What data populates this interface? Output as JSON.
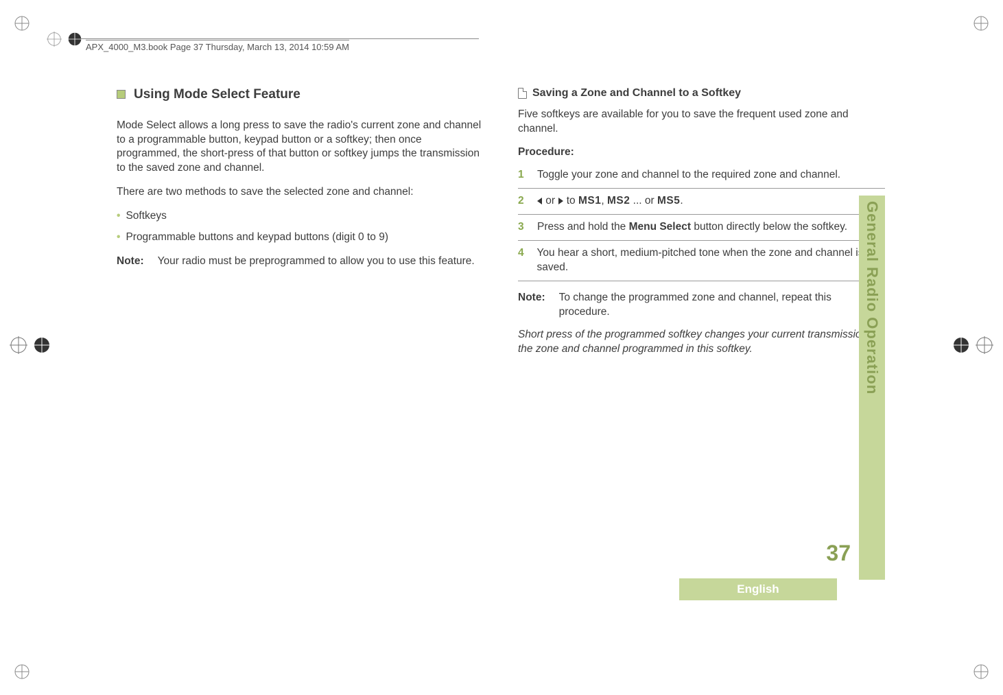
{
  "header": "APX_4000_M3.book  Page 37  Thursday, March 13, 2014  10:59 AM",
  "sideTab": "General Radio Operation",
  "pageNumber": "37",
  "language": "English",
  "left": {
    "title": "Using Mode Select Feature",
    "p1": "Mode Select allows a long press to save the radio's current zone and channel to a programmable button, keypad button or a softkey; then once programmed, the short-press of that button or softkey jumps the transmission to the saved zone and channel.",
    "p2": "There are two methods to save the selected zone and channel:",
    "bullets": [
      "Softkeys",
      "Programmable buttons and keypad buttons (digit 0 to 9)"
    ],
    "noteLabel": "Note:",
    "noteBody": "Your radio must be preprogrammed to allow you to use this feature."
  },
  "right": {
    "subTitle": "Saving a Zone and Channel to a Softkey",
    "intro": "Five softkeys are available for you to save the frequent used zone and channel.",
    "procLabel": "Procedure:",
    "step1": "Toggle your zone and channel to the required zone and channel.",
    "step2_or": " or ",
    "step2_to": " to ",
    "ms1": "MS1",
    "ms2": "MS2",
    "ms5": "MS5",
    "step2_sep": ", ",
    "step2_dots": " ... or ",
    "step2_end": ".",
    "step3a": "Press and hold the ",
    "step3b": "Menu Select",
    "step3c": " button directly below the softkey.",
    "step4": "You hear a short, medium-pitched tone when the zone and channel is saved.",
    "noteLabel": "Note:",
    "noteBody": "To change the programmed zone and channel, repeat this procedure.",
    "italic": "Short press of the programmed softkey changes your current transmission to the zone and channel programmed in this softkey."
  },
  "steps": {
    "n1": "1",
    "n2": "2",
    "n3": "3",
    "n4": "4"
  }
}
